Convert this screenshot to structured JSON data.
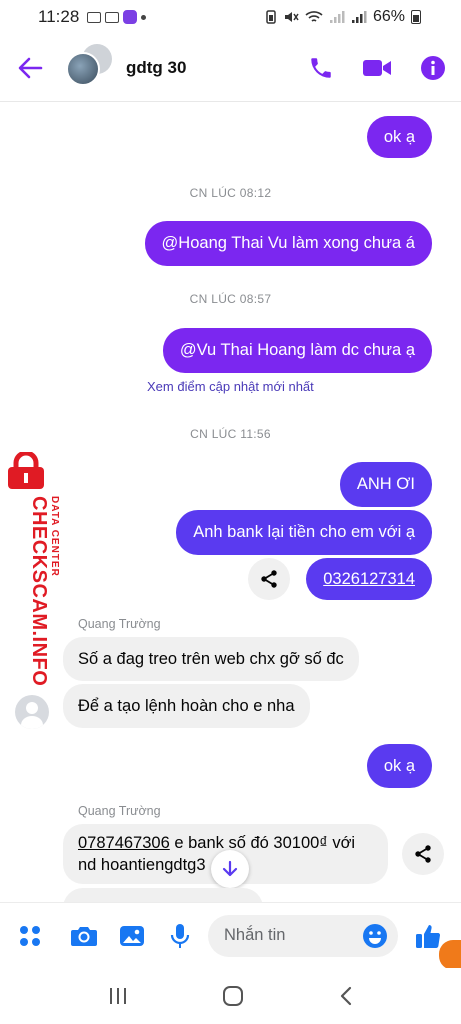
{
  "status_bar": {
    "time": "11:28",
    "battery": "66%"
  },
  "header": {
    "contact_name": "gdtg 30"
  },
  "colors": {
    "accent": "#7b27f0",
    "bubble_blue": "#5a3af0",
    "incoming_bg": "#f0f0f0",
    "watermark": "#e01b24"
  },
  "messages": {
    "ok_1": "ok ạ",
    "ts_1": "CN LÚC 08:12",
    "mention_1": "@Hoang Thai Vu làm xong chưa á",
    "ts_2": "CN LÚC 08:57",
    "mention_2": "@Vu Thai Hoang làm dc chưa ạ",
    "update_link": "Xem điểm cập nhật mới nhất",
    "ts_3": "CN LÚC 11:56",
    "anh_oi": "ANH ƠI",
    "bank_request": "Anh bank lại tiền cho em với ạ",
    "phone_number": "0326127314",
    "sender_1": "Quang Trường",
    "in_1": "Số a đag treo trên web chx gỡ số đc",
    "in_2": "Để a tạo lệnh hoàn cho e nha",
    "ok_2": "ok ạ",
    "sender_2": "Quang Trường",
    "in_3_link": "0787467306",
    "in_3_line1": " e bank số đó 30100₫ với",
    "in_3_line2": "nd hoantiengdtg3"
  },
  "watermark": {
    "main": "CHECKSCAM.INFO",
    "sub": "DATA CENTER"
  },
  "composer": {
    "placeholder": "Nhắn tin"
  }
}
